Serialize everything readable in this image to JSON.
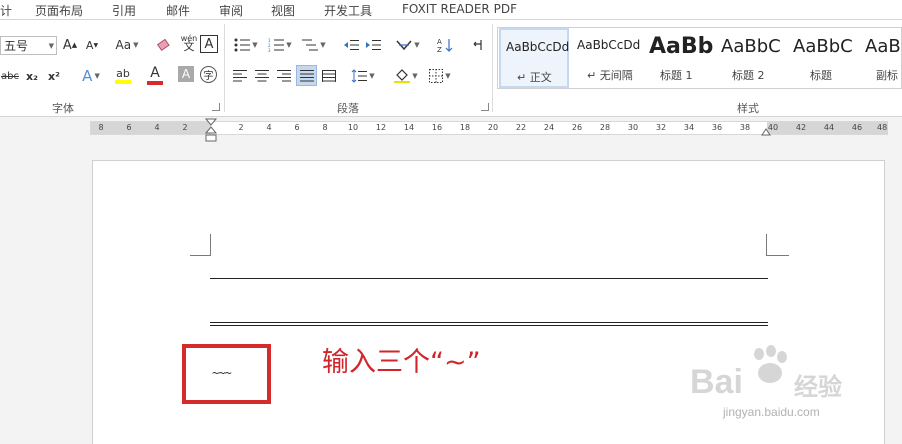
{
  "tabs": [
    "计",
    "页面布局",
    "引用",
    "邮件",
    "审阅",
    "视图",
    "开发工具",
    "FOXIT READER PDF"
  ],
  "font": {
    "size_value": "五号",
    "grow_label": "A",
    "shrink_label": "A",
    "case_label": "Aa",
    "phonetic_label": "wén",
    "border_char_label": "A",
    "strike_label": "abc",
    "sub_label": "x₂",
    "sup_label": "x²",
    "effects_label": "A",
    "highlight_label": "ab",
    "color_label": "A",
    "shading_label": "A",
    "enclose_label": "字",
    "group_label": "字体"
  },
  "paragraph": {
    "group_label": "段落"
  },
  "styles": {
    "group_label": "样式",
    "items": [
      {
        "sample": "AaBbCcDd",
        "name": "↵ 正文"
      },
      {
        "sample": "AaBbCcDd",
        "name": "↵ 无间隔"
      },
      {
        "sample": "AaBb",
        "name": "标题 1"
      },
      {
        "sample": "AaBbC",
        "name": "标题 2"
      },
      {
        "sample": "AaBbC",
        "name": "标题"
      },
      {
        "sample": "AaBl",
        "name": "副标"
      }
    ]
  },
  "ruler": {
    "left_ticks": [
      "8",
      "6",
      "4",
      "2"
    ],
    "right_ticks": [
      "2",
      "4",
      "6",
      "8",
      "10",
      "12",
      "14",
      "16",
      "18",
      "20",
      "22",
      "24",
      "26",
      "28",
      "30",
      "32",
      "34",
      "36",
      "38",
      "40",
      "42",
      "44",
      "46",
      "48"
    ]
  },
  "document": {
    "typed_text": "~~~",
    "annotation": "输入三个“~”"
  },
  "watermark": {
    "logo": "Bai",
    "logo_cn": "经验",
    "url": "jingyan.baidu.com"
  },
  "colors": {
    "accent_red": "#d62b2b",
    "annotation_red": "#d0262b",
    "style_selected": "#c5d8ef"
  }
}
